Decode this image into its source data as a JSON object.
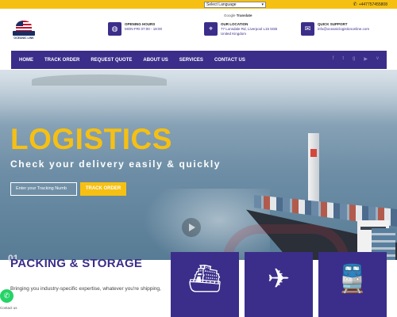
{
  "topbar": {
    "language_select": "Select Language",
    "phone": "+447757455808",
    "google_translate_prefix": "Google",
    "google_translate_label": "Translate"
  },
  "logo": {
    "name": "OCEANIC LINK"
  },
  "header": {
    "hours": {
      "title": "OPENING HOURS",
      "value": "MON-FRI 07:00 - 18:00"
    },
    "location": {
      "title": "OUR LOCATION",
      "value_line1": "77 Lonsdale Rd, Liverpool L15 5GB",
      "value_line2": "United Kingdom"
    },
    "support": {
      "title": "QUICK SUPPORT",
      "value": "info@oceaniclogisticsonline.com"
    }
  },
  "nav": {
    "items": [
      "HOME",
      "TRACK ORDER",
      "REQUEST QUOTE",
      "ABOUT US",
      "SERVICES",
      "CONTACT US"
    ],
    "social_icons": [
      "facebook-icon",
      "twitter-icon",
      "google-plus-icon",
      "youtube-icon",
      "vimeo-icon"
    ]
  },
  "hero": {
    "title": "LOGISTICS",
    "subtitle": "Check your delivery easily & quickly",
    "input_placeholder": "Enter your Tracking Numb",
    "button_label": "TRACK ORDER"
  },
  "section": {
    "number": "01",
    "title": "PACKING & STORAGE",
    "text": "Bringing you industry-specific expertise, whatever you're shipping,"
  },
  "services": {
    "icons": [
      "ship-icon",
      "airplane-icon",
      "train-icon"
    ]
  },
  "whatsapp": {
    "label": "Contact us"
  },
  "colors": {
    "brand_purple": "#3b2e8a",
    "accent_yellow": "#f6c013",
    "whatsapp_green": "#25d366"
  }
}
